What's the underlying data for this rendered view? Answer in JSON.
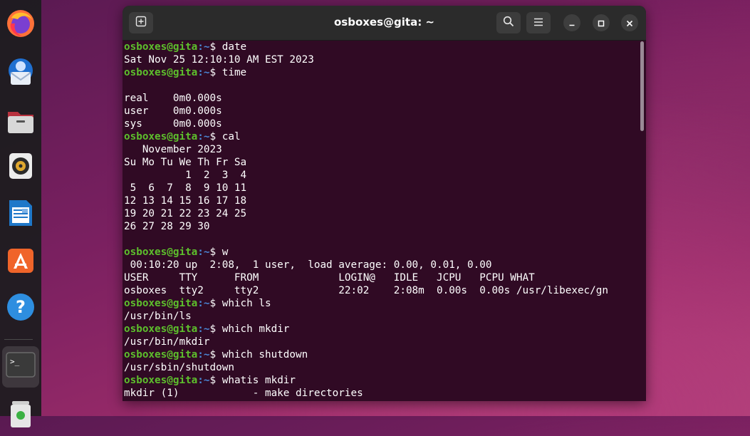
{
  "dock": {
    "items": [
      {
        "name": "firefox-icon"
      },
      {
        "name": "thunderbird-icon"
      },
      {
        "name": "files-icon"
      },
      {
        "name": "rhythmbox-icon"
      },
      {
        "name": "libreoffice-writer-icon"
      },
      {
        "name": "app-center-icon"
      },
      {
        "name": "help-icon"
      },
      {
        "name": "terminal-icon"
      },
      {
        "name": "trash-icon"
      }
    ]
  },
  "window": {
    "title": "osboxes@gita: ~"
  },
  "terminal": {
    "prompt_user": "osboxes@gita",
    "prompt_path": ":~",
    "prompt_sigil": "$ ",
    "lines": [
      {
        "type": "prompt",
        "cmd": "date"
      },
      {
        "type": "out",
        "text": "Sat Nov 25 12:10:10 AM EST 2023"
      },
      {
        "type": "prompt",
        "cmd": "time"
      },
      {
        "type": "out",
        "text": ""
      },
      {
        "type": "out",
        "text": "real    0m0.000s"
      },
      {
        "type": "out",
        "text": "user    0m0.000s"
      },
      {
        "type": "out",
        "text": "sys     0m0.000s"
      },
      {
        "type": "prompt",
        "cmd": "cal"
      },
      {
        "type": "out",
        "text": "   November 2023"
      },
      {
        "type": "out",
        "text": "Su Mo Tu We Th Fr Sa"
      },
      {
        "type": "out",
        "text": "          1  2  3  4"
      },
      {
        "type": "out",
        "text": " 5  6  7  8  9 10 11"
      },
      {
        "type": "out",
        "text": "12 13 14 15 16 17 18"
      },
      {
        "type": "out",
        "text": "19 20 21 22 23 24 25"
      },
      {
        "type": "out",
        "text": "26 27 28 29 30"
      },
      {
        "type": "out",
        "text": ""
      },
      {
        "type": "prompt",
        "cmd": "w"
      },
      {
        "type": "out",
        "text": " 00:10:20 up  2:08,  1 user,  load average: 0.00, 0.01, 0.00"
      },
      {
        "type": "out",
        "text": "USER     TTY      FROM             LOGIN@   IDLE   JCPU   PCPU WHAT"
      },
      {
        "type": "out",
        "text": "osboxes  tty2     tty2             22:02    2:08m  0.00s  0.00s /usr/libexec/gn"
      },
      {
        "type": "prompt",
        "cmd": "which ls"
      },
      {
        "type": "out",
        "text": "/usr/bin/ls"
      },
      {
        "type": "prompt",
        "cmd": "which mkdir"
      },
      {
        "type": "out",
        "text": "/usr/bin/mkdir"
      },
      {
        "type": "prompt",
        "cmd": "which shutdown"
      },
      {
        "type": "out",
        "text": "/usr/sbin/shutdown"
      },
      {
        "type": "prompt",
        "cmd": "whatis mkdir"
      },
      {
        "type": "out",
        "text": "mkdir (1)            - make directories"
      }
    ]
  },
  "colors": {
    "terminal_bg": "#300a24",
    "prompt_user": "#5dbf2c",
    "prompt_path": "#4a87d6"
  }
}
